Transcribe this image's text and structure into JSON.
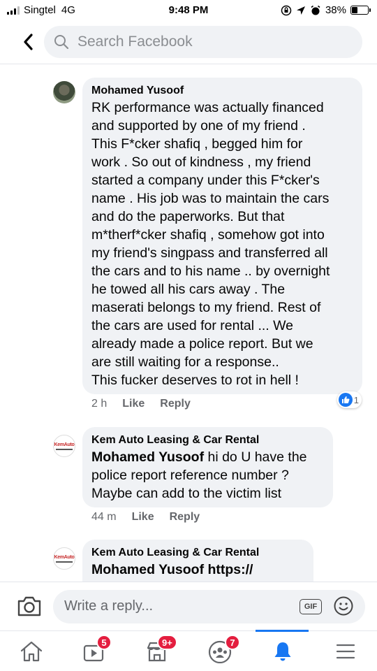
{
  "status_bar": {
    "carrier": "Singtel",
    "network": "4G",
    "time": "9:48 PM",
    "battery": "38%",
    "battery_level": 0.38
  },
  "header": {
    "search_placeholder": "Search Facebook",
    "icons": {
      "back": "chevron-left-icon",
      "search": "search-icon"
    }
  },
  "comments": [
    {
      "author": "Mohamed Yusoof",
      "text": "RK performance was actually financed\nand supported by one of my friend .\nThis F*cker shafiq , begged him for\nwork . So out of kindness , my friend\nstarted a company under this F*cker's\nname . His job was to maintain the cars\nand do the paperworks. But that\nm*therf*cker shafiq , somehow got into\nmy friend's singpass and transferred all\nthe cars and to his name .. by overnight\nhe towed all his cars away . The\nmaserati belongs to my friend. Rest of\nthe cars are used for rental ... We\nalready made a police report. But we\nare still waiting for a response..\nThis fucker deserves to rot in hell !",
      "time": "2 h",
      "like_label": "Like",
      "reply_label": "Reply",
      "reaction_count": "1"
    },
    {
      "author": "Kem Auto Leasing & Car Rental",
      "logo_text": "KemAuto",
      "mention": "Mohamed Yusoof",
      "text": " hi do U have the\npolice report reference number ?\nMaybe can add to the victim list",
      "time": "44 m",
      "like_label": "Like",
      "reply_label": "Reply"
    },
    {
      "author": "Kem Auto Leasing & Car Rental",
      "logo_text": "KemAuto",
      "mention": "Mohamed Yusoof",
      "text": " https://"
    }
  ],
  "reply_bar": {
    "placeholder": "Write a reply...",
    "gif_label": "GIF"
  },
  "bottom_nav": {
    "items": [
      {
        "name": "home",
        "icon": "home-icon"
      },
      {
        "name": "watch",
        "icon": "video-icon",
        "badge": "5"
      },
      {
        "name": "marketplace",
        "icon": "marketplace-icon",
        "badge": "9+"
      },
      {
        "name": "groups",
        "icon": "groups-icon",
        "badge": "7"
      },
      {
        "name": "notifications",
        "icon": "bell-icon",
        "active": true
      },
      {
        "name": "menu",
        "icon": "menu-icon"
      }
    ]
  },
  "colors": {
    "accent": "#1877f2",
    "bubble": "#f0f2f5",
    "badge": "#e41e3f",
    "meta_text": "#65676b"
  }
}
